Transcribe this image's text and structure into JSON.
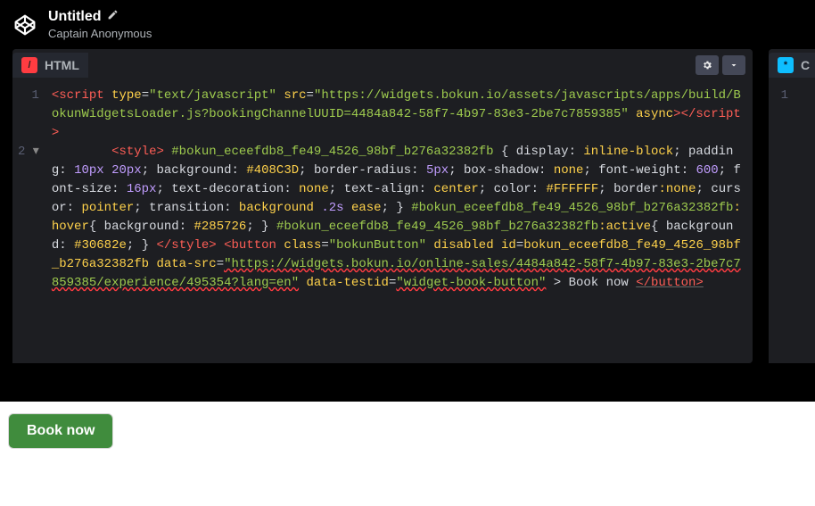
{
  "header": {
    "title": "Untitled",
    "author": "Captain Anonymous"
  },
  "panels": {
    "html": {
      "label": "HTML",
      "icon": "/"
    },
    "c": {
      "label": "C",
      "icon": "*"
    }
  },
  "gutter": {
    "l1": "1",
    "l2": "2"
  },
  "code": {
    "l1": {
      "open": "<",
      "script": "script",
      "sp": " ",
      "type": "type",
      "eq": "=",
      "typev": "\"text/javascript\"",
      "src": "src",
      "srcv": "\"https://widgets.bokun.io/assets/javascripts/apps/build/BokunWidgetsLoader.js?bookingChannelUUID=4484a842-58f7-4b97-83e3-2be7c7859385\"",
      "async": "async",
      "close1": ">",
      "closetag": "</",
      "close2": ">"
    },
    "l2": {
      "indent": "        ",
      "styleopen": "<style>",
      "sel1": " #bokun_eceefdb8_fe49_4526_98bf_b276a32382fb ",
      "ob": "{ ",
      "p_display": "display",
      "col": ": ",
      "v_display": "inline-block",
      "sc": "; ",
      "p_padding": "padding",
      "v_padding1": "10px",
      "v_padding2": "20px",
      "p_bg": "background",
      "v_bg": "#408C3D",
      "p_br": "border-radius",
      "v_br": "5px",
      "p_bs": "box-shadow",
      "v_bs": "none",
      "p_fw": "font-weight",
      "v_fw": "600",
      "p_fs": "font-size",
      "v_fs": "16px",
      "p_td": "text-decoration",
      "v_td": "none",
      "p_ta": "text-align",
      "v_ta": "center",
      "p_color": "color",
      "v_color": "#FFFFFF",
      "p_border": "border",
      "v_border": ":none",
      "p_cursor": "cursor",
      "v_cursor": "pointer",
      "p_trans": "transition",
      "v_trans": "background ",
      "v_trans_dur": ".2s",
      "v_trans_ease": " ease",
      "cb": "} ",
      "sel_hover": "#bokun_eceefdb8_fe49_4526_98bf_b276a32382fb",
      "hover": ":hover",
      "ob2": "{ ",
      "v_hoverbg": "#285726",
      "cb2": "} ",
      "active": ":active",
      "ob3": "{ ",
      "v_activebg": "#30682e",
      "cb3": "} ",
      "styleclose": "</style>",
      "buttonopen": "<button ",
      "class": "class",
      "classv": "\"bokunButton\"",
      "disabled": "disabled",
      "id": "id",
      "idvp": "=",
      "idv": "bokun_eceefdb8_fe49_4526_98bf_b276a32382fb",
      "datasrc": "data-src",
      "datasrcv1": "\"https://widgets.bokun.io/online-sales/4484a842-58f7-4b97-83e3-2be7c7859385/experience/495354?",
      "datasrcv2": "lang=en\"",
      "testid": "data-testid",
      "testidv": "\"widget-book-button\"",
      "gt": " > ",
      "booknow": "Book now ",
      "buttonclose": "</button>"
    }
  },
  "output": {
    "book_now": "Book now"
  }
}
